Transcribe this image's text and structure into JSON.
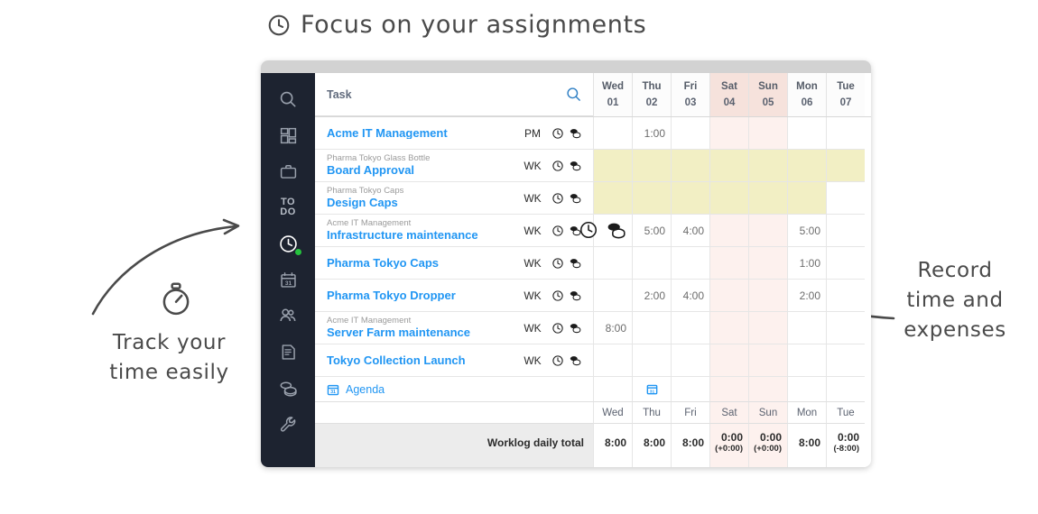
{
  "annotations": {
    "title": "Focus on your assignments",
    "title_icon": "clock-icon",
    "left": "Track your\ntime easily",
    "left_line1": "Track your",
    "left_line2": "time easily",
    "left_icon": "stopwatch-icon",
    "right_line1": "Record",
    "right_line2": "time and",
    "right_line3": "expenses"
  },
  "sidebar": {
    "items": [
      {
        "name": "search-icon",
        "type": "icon",
        "label": ""
      },
      {
        "name": "dashboard-icon",
        "type": "icon",
        "label": ""
      },
      {
        "name": "briefcase-icon",
        "type": "icon",
        "label": ""
      },
      {
        "name": "todo-label",
        "type": "text",
        "label": "TO\nDO",
        "line1": "TO",
        "line2": "DO"
      },
      {
        "name": "clock-icon",
        "type": "icon",
        "label": "",
        "active": true,
        "badge": true
      },
      {
        "name": "calendar-icon",
        "type": "icon",
        "label": "31"
      },
      {
        "name": "people-icon",
        "type": "icon",
        "label": ""
      },
      {
        "name": "document-icon",
        "type": "icon",
        "label": ""
      },
      {
        "name": "coins-icon",
        "type": "icon",
        "label": ""
      },
      {
        "name": "wrench-icon",
        "type": "icon",
        "label": ""
      }
    ]
  },
  "table": {
    "task_header": "Task",
    "search_icon": "search-icon",
    "days": [
      {
        "name": "Wed",
        "num": "01",
        "weekend": false
      },
      {
        "name": "Thu",
        "num": "02",
        "weekend": false
      },
      {
        "name": "Fri",
        "num": "03",
        "weekend": false
      },
      {
        "name": "Sat",
        "num": "04",
        "weekend": true
      },
      {
        "name": "Sun",
        "num": "05",
        "weekend": true
      },
      {
        "name": "Mon",
        "num": "06",
        "weekend": false
      },
      {
        "name": "Tue",
        "num": "07",
        "weekend": false
      }
    ],
    "rows": [
      {
        "parent": "",
        "task": "Acme IT Management",
        "code": "PM",
        "icons": [
          "clock-icon",
          "coins-icon"
        ],
        "values": [
          "",
          "1:00",
          "",
          "",
          "",
          "",
          ""
        ],
        "band": [
          false,
          false,
          false,
          false,
          false,
          false,
          false
        ]
      },
      {
        "parent": "Pharma Tokyo Glass Bottle",
        "task": "Board Approval",
        "code": "WK",
        "icons": [
          "clock-icon",
          "coins-icon"
        ],
        "values": [
          "",
          "",
          "",
          "",
          "",
          "",
          ""
        ],
        "band": [
          true,
          true,
          true,
          true,
          true,
          true,
          true
        ]
      },
      {
        "parent": "Pharma Tokyo Caps",
        "task": "Design Caps",
        "code": "WK",
        "icons": [
          "clock-icon",
          "coins-icon"
        ],
        "values": [
          "",
          "",
          "",
          "",
          "",
          "",
          ""
        ],
        "band": [
          true,
          true,
          true,
          true,
          true,
          true,
          false
        ]
      },
      {
        "parent": "Acme IT Management",
        "task": "Infrastructure maintenance",
        "code": "WK",
        "icons": [
          "clock-icon",
          "coins-icon"
        ],
        "values": [
          "",
          "5:00",
          "4:00",
          "",
          "",
          "5:00",
          ""
        ],
        "band": [
          false,
          false,
          false,
          false,
          false,
          false,
          false
        ]
      },
      {
        "parent": "",
        "task": "Pharma Tokyo Caps",
        "code": "WK",
        "icons": [
          "clock-icon",
          "coins-icon"
        ],
        "values": [
          "",
          "",
          "",
          "",
          "",
          "1:00",
          ""
        ],
        "band": [
          false,
          false,
          false,
          false,
          false,
          false,
          false
        ]
      },
      {
        "parent": "",
        "task": "Pharma Tokyo Dropper",
        "code": "WK",
        "icons": [
          "clock-icon",
          "coins-icon"
        ],
        "values": [
          "",
          "2:00",
          "4:00",
          "",
          "",
          "2:00",
          ""
        ],
        "band": [
          false,
          false,
          false,
          false,
          false,
          false,
          false
        ]
      },
      {
        "parent": "Acme IT Management",
        "task": "Server Farm maintenance",
        "code": "WK",
        "icons": [
          "clock-icon",
          "coins-icon"
        ],
        "values": [
          "8:00",
          "",
          "",
          "",
          "",
          "",
          ""
        ],
        "band": [
          false,
          false,
          false,
          false,
          false,
          false,
          false
        ]
      },
      {
        "parent": "",
        "task": "Tokyo Collection Launch",
        "code": "WK",
        "icons": [
          "clock-icon",
          "coins-icon"
        ],
        "values": [
          "",
          "",
          "",
          "",
          "",
          "",
          ""
        ],
        "band": [
          false,
          false,
          false,
          false,
          false,
          false,
          false
        ]
      }
    ],
    "agenda": {
      "label": "Agenda",
      "icon": "calendar-icon",
      "markers": [
        false,
        true,
        false,
        false,
        false,
        false,
        false
      ]
    },
    "footer": {
      "totals_label": "Worklog daily total",
      "totals": [
        {
          "main": "8:00",
          "sub": ""
        },
        {
          "main": "8:00",
          "sub": ""
        },
        {
          "main": "8:00",
          "sub": ""
        },
        {
          "main": "0:00",
          "sub": "(+0:00)"
        },
        {
          "main": "0:00",
          "sub": "(+0:00)"
        },
        {
          "main": "8:00",
          "sub": ""
        },
        {
          "main": "0:00",
          "sub": "(-8:00)"
        }
      ]
    }
  },
  "highlight": {
    "icons": [
      "clock-icon",
      "coins-icon"
    ]
  },
  "colors": {
    "sidebar_bg": "#1d2330",
    "link_blue": "#2196f3",
    "band_yellow": "#f2efc4",
    "weekend_tint": "#fdf1ee",
    "weekend_header": "#f6e2dc",
    "badge_green": "#25c23d",
    "ink": "#4a4a4a"
  }
}
